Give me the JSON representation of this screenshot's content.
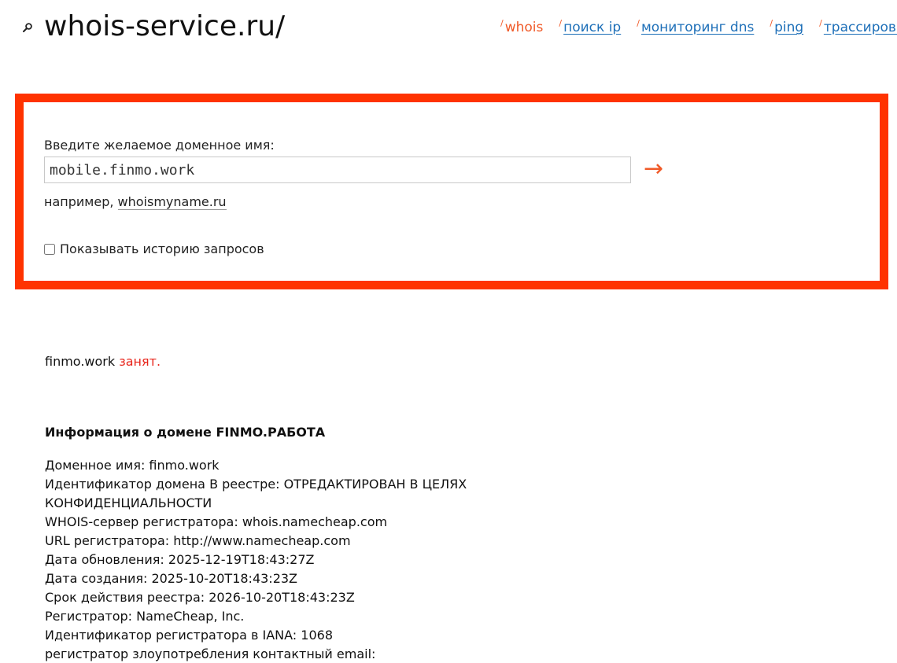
{
  "header": {
    "logo_text": "whois-service.ru/",
    "icon": "search-icon"
  },
  "nav": {
    "slash": "/",
    "items": [
      {
        "label": "whois",
        "active": true
      },
      {
        "label": "поиск ip",
        "active": false
      },
      {
        "label": "мониторинг dns",
        "active": false
      },
      {
        "label": "ping",
        "active": false
      },
      {
        "label": "трассировка",
        "active": false
      }
    ]
  },
  "search": {
    "label": "Введите желаемое доменное имя:",
    "value": "mobile.finmo.work",
    "submit_icon": "arrow-right-icon",
    "submit_glyph": "→",
    "example_prefix": "например,",
    "example_link": "whoismyname.ru",
    "history_label": "Показывать историю запросов",
    "history_checked": false
  },
  "result": {
    "domain": "finmo.work",
    "status": "занят."
  },
  "info": {
    "heading": "Информация о домене FINMO.РАБОТА",
    "lines": [
      "Доменное имя: finmo.work",
      "Идентификатор домена В реестре: ОТРЕДАКТИРОВАН В ЦЕЛЯХ КОНФИДЕНЦИАЛЬНОСТИ",
      "WHOIS-сервер регистратора: whois.namecheap.com",
      "URL регистратора: http://www.namecheap.com",
      "Дата обновления: 2025-12-19T18:43:27Z",
      "Дата создания: 2025-10-20T18:43:23Z",
      "Срок действия реестра: 2026-10-20T18:43:23Z",
      "Регистратор: NameCheap, Inc.",
      "Идентификатор регистратора в IANA: 1068",
      "регистратор злоупотребления контактный email: abuse@namecheap.com"
    ]
  },
  "colors": {
    "accent": "#f05a28",
    "panel_border": "#ff3300",
    "link": "#1d6fb8",
    "status_taken": "#e8261c"
  }
}
